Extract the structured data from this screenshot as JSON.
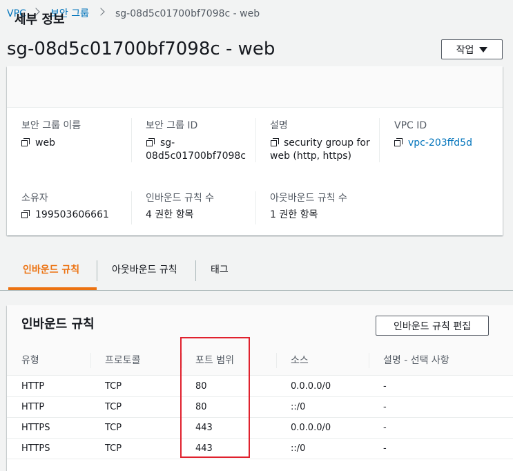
{
  "breadcrumb": {
    "vpc": "VPC",
    "security_groups": "보안 그룹",
    "current": "sg-08d5c01700bf7098c - web"
  },
  "page": {
    "title": "sg-08d5c01700bf7098c - web",
    "action_button": "작업"
  },
  "details": {
    "title": "세부 정보",
    "name_label": "보안 그룹 이름",
    "name_value": "web",
    "id_label": "보안 그룹 ID",
    "id_value_line1": "sg-",
    "id_value_line2": "08d5c01700bf7098c",
    "desc_label": "설명",
    "desc_value_line1": "security group for",
    "desc_value_line2": "web (http, https)",
    "vpc_label": "VPC ID",
    "vpc_value": "vpc-203ffd5d",
    "owner_label": "소유자",
    "owner_value": "199503606661",
    "inbound_count_label": "인바운드 규칙 수",
    "inbound_count_value": "4 권한 항목",
    "outbound_count_label": "아웃바운드 규칙 수",
    "outbound_count_value": "1 권한 항목"
  },
  "tabs": {
    "inbound": "인바운드 규칙",
    "outbound": "아웃바운드 규칙",
    "tags": "태그"
  },
  "rules": {
    "title": "인바운드 규칙",
    "edit_button": "인바운드 규칙 편집",
    "columns": [
      "유형",
      "프로토콜",
      "포트 범위",
      "소스",
      "설명 - 선택 사항"
    ],
    "rows": [
      [
        "HTTP",
        "TCP",
        "80",
        "0.0.0.0/0",
        "-"
      ],
      [
        "HTTP",
        "TCP",
        "80",
        "::/0",
        "-"
      ],
      [
        "HTTPS",
        "TCP",
        "443",
        "0.0.0.0/0",
        "-"
      ],
      [
        "HTTPS",
        "TCP",
        "443",
        "::/0",
        "-"
      ]
    ]
  },
  "colors": {
    "link": "#0073bb",
    "active_tab": "#ec7211",
    "highlight_border": "#e0212d"
  }
}
